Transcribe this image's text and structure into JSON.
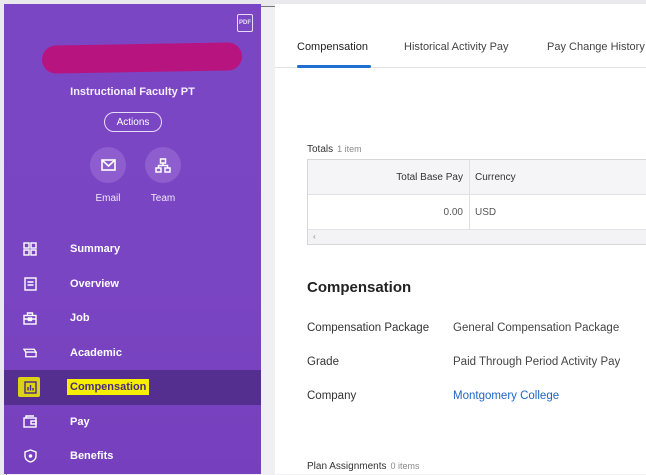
{
  "sidebar": {
    "profile_title": "Instructional Faculty PT",
    "actions_label": "Actions",
    "quick_actions": [
      {
        "label": "Email",
        "icon": "envelope-icon"
      },
      {
        "label": "Team",
        "icon": "org-chart-icon"
      }
    ],
    "items": [
      {
        "label": "Summary",
        "icon": "grid-icon"
      },
      {
        "label": "Overview",
        "icon": "document-icon"
      },
      {
        "label": "Job",
        "icon": "briefcase-icon"
      },
      {
        "label": "Academic",
        "icon": "academic-icon"
      },
      {
        "label": "Compensation",
        "icon": "bar-chart-icon",
        "active": true
      },
      {
        "label": "Pay",
        "icon": "wallet-icon"
      },
      {
        "label": "Benefits",
        "icon": "shield-icon"
      }
    ],
    "pdf_label": "PDF"
  },
  "tabs": [
    {
      "label": "Compensation",
      "active": true
    },
    {
      "label": "Historical Activity Pay"
    },
    {
      "label": "Pay Change History"
    }
  ],
  "totals": {
    "title": "Totals",
    "count": "1 item",
    "columns": [
      "Total Base Pay",
      "Currency"
    ],
    "rows": [
      [
        "0.00",
        "USD"
      ]
    ]
  },
  "compensation": {
    "title": "Compensation",
    "fields": [
      {
        "label": "Compensation Package",
        "value": "General Compensation Package"
      },
      {
        "label": "Grade",
        "value": "Paid Through Period Activity Pay"
      },
      {
        "label": "Company",
        "value": "Montgomery College",
        "link": true
      }
    ]
  },
  "plan_assignments": {
    "title": "Plan Assignments",
    "count": "0 items"
  },
  "colors": {
    "sidebar": "#7b46c4",
    "active_nav": "#552f8f",
    "highlight": "#f6f000",
    "accent": "#1f6fce",
    "link": "#1e66c4"
  }
}
